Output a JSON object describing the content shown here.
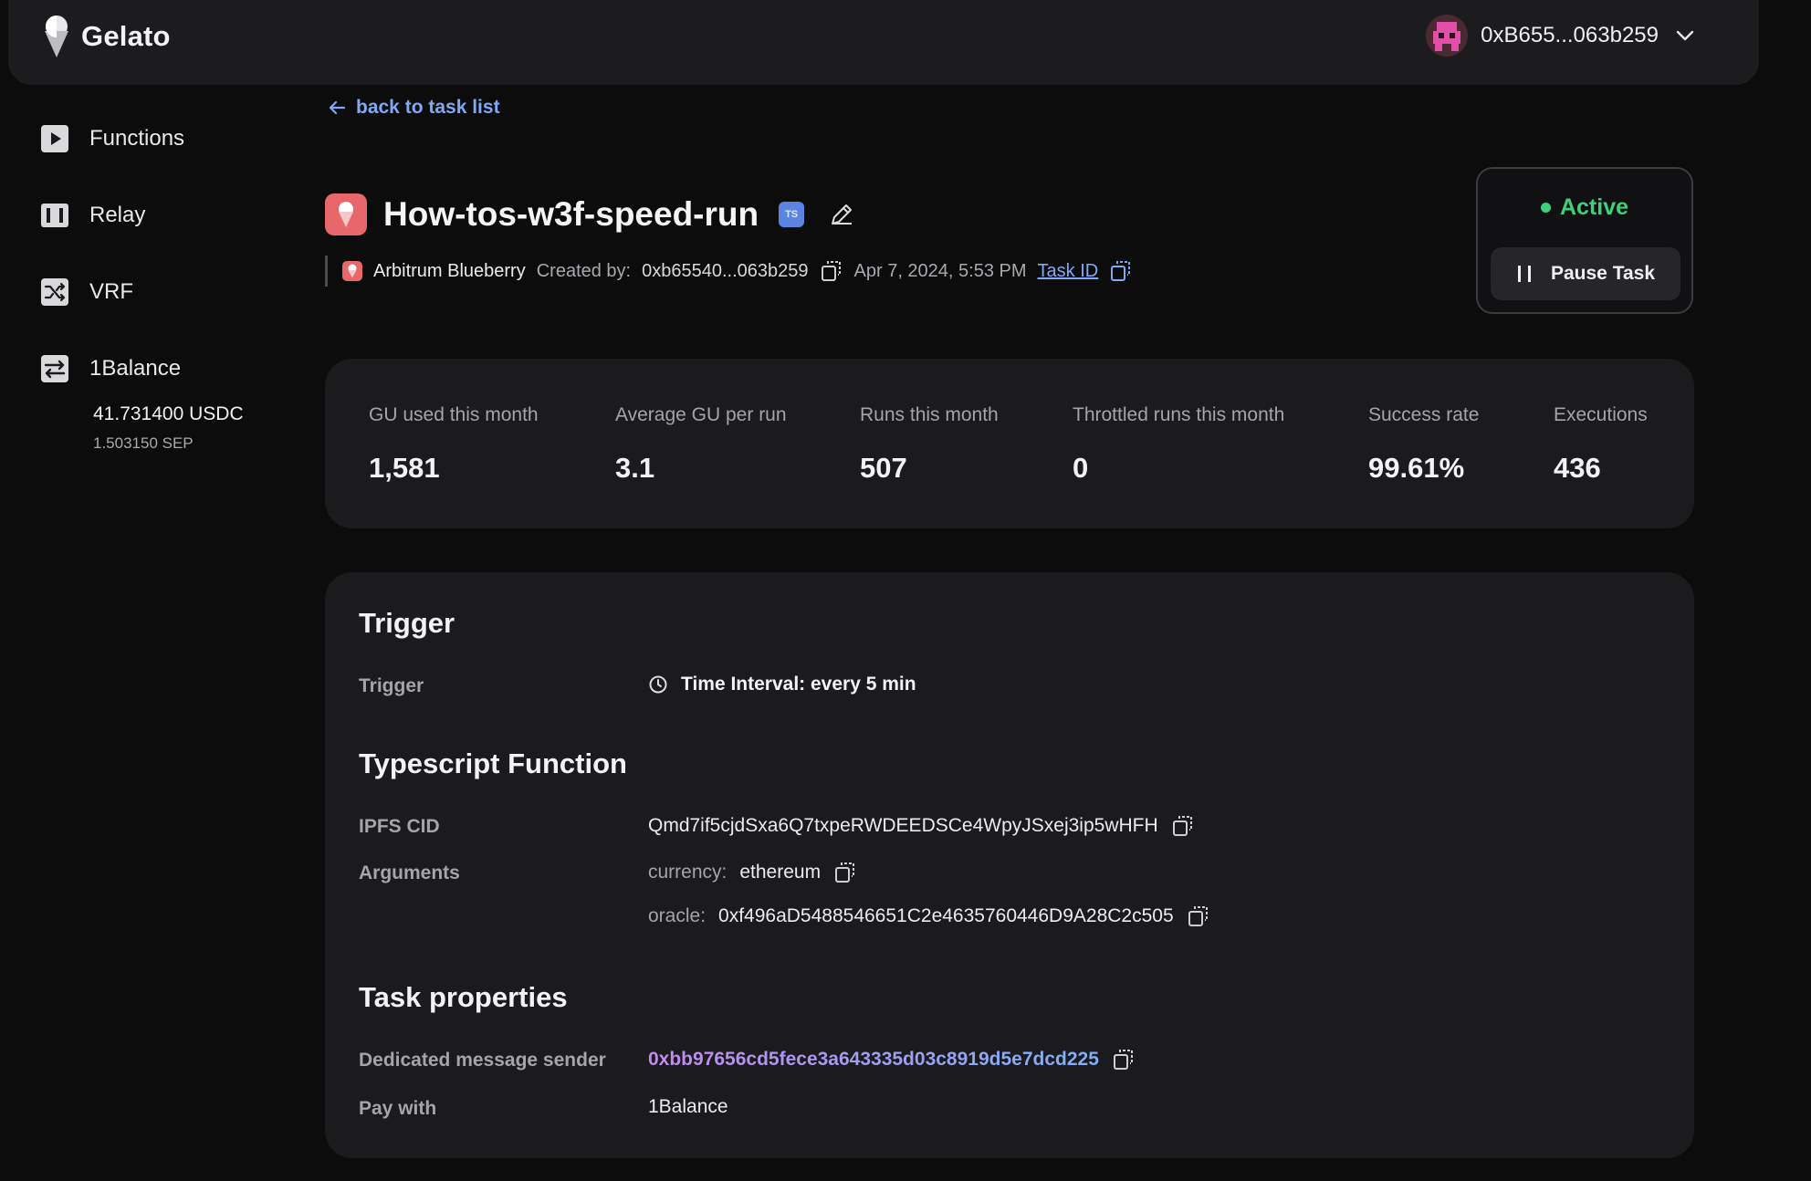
{
  "app": {
    "name": "Gelato"
  },
  "account": {
    "address": "0xB655...063b259"
  },
  "sidebar": {
    "items": [
      {
        "label": "Functions",
        "icon": "play-square-icon"
      },
      {
        "label": "Relay",
        "icon": "relay-icon"
      },
      {
        "label": "VRF",
        "icon": "shuffle-icon"
      },
      {
        "label": "1Balance",
        "icon": "transfer-icon"
      }
    ],
    "balance_usdc": "41.731400 USDC",
    "balance_sep": "1.503150 SEP"
  },
  "back_link": "back to task list",
  "task": {
    "name": "How-tos-w3f-speed-run",
    "badge": "TS",
    "chain": "Arbitrum Blueberry",
    "created_by_label": "Created by:",
    "creator": "0xb65540...063b259",
    "date": "Apr 7, 2024, 5:53 PM",
    "task_id_label": "Task ID"
  },
  "status": {
    "label": "Active",
    "color": "#3fcf7a",
    "pause_label": "Pause Task"
  },
  "stats": [
    {
      "label": "GU used this month",
      "value": "1,581"
    },
    {
      "label": "Average GU per run",
      "value": "3.1"
    },
    {
      "label": "Runs this month",
      "value": "507"
    },
    {
      "label": "Throttled runs this month",
      "value": "0"
    },
    {
      "label": "Success rate",
      "value": "99.61%"
    },
    {
      "label": "Executions",
      "value": "436"
    }
  ],
  "trigger": {
    "title": "Trigger",
    "label": "Trigger",
    "value": "Time Interval: every 5 min"
  },
  "function": {
    "title": "Typescript Function",
    "ipfs_label": "IPFS CID",
    "ipfs_value": "Qmd7if5cjdSxa6Q7txpeRWDEEDSCe4WpyJSxej3ip5wHFH",
    "args_label": "Arguments",
    "args": [
      {
        "key": "currency:",
        "value": "ethereum"
      },
      {
        "key": "oracle:",
        "value": "0xf496aD5488546651C2e4635760446D9A28C2c505"
      }
    ]
  },
  "properties": {
    "title": "Task properties",
    "sender_label": "Dedicated message sender",
    "sender_value": "0xbb97656cd5fece3a643335d03c8919d5e7dcd225",
    "pay_label": "Pay with",
    "pay_value": "1Balance"
  }
}
